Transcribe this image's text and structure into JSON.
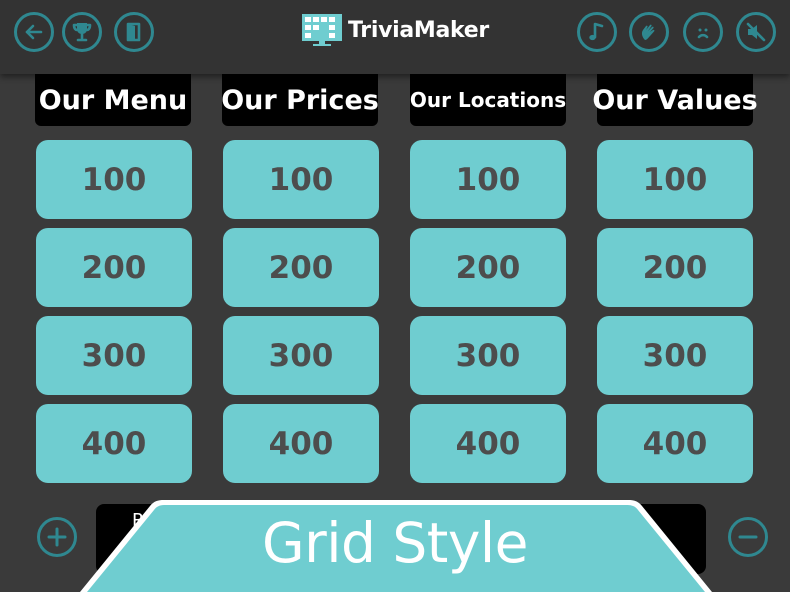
{
  "toolbar": {
    "left_icons": [
      "back-arrow-icon",
      "trophy-icon",
      "exit-door-icon"
    ],
    "right_icons": [
      "music-note-icon",
      "clapping-hands-icon",
      "sad-face-icon",
      "mute-icon"
    ]
  },
  "brand": {
    "name": "TriviaMaker"
  },
  "board": {
    "categories": [
      "Our Menu",
      "Our Prices",
      "Our Locations",
      "Our Values"
    ],
    "values": [
      "100",
      "200",
      "300",
      "400"
    ]
  },
  "footer": {
    "hidden_text": "R",
    "left_button": "plus-icon",
    "right_button": "minus-icon"
  },
  "banner": {
    "title": "Grid Style"
  },
  "colors": {
    "background": "#3a3a3a",
    "topbar": "#333333",
    "accent": "#2f8890",
    "tile": "#6fcdd0",
    "tile_text": "#4d4d4d",
    "category_bg": "#000000",
    "banner": "#6fcdd0"
  }
}
